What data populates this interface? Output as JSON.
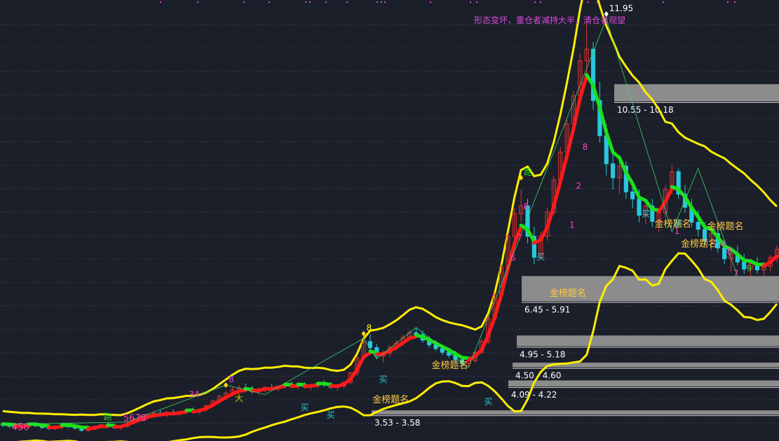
{
  "chart_data": {
    "type": "candlestick",
    "ylim": [
      3.0,
      12.2
    ],
    "peak_label": "11.95",
    "annotation_text": "形态变坏，重仓者减持大半，清仓者观望",
    "zones": [
      {
        "low": 10.18,
        "high": 10.55,
        "label": "10.55 - 10.18"
      },
      {
        "low": 5.91,
        "high": 6.45,
        "label": "6.45 - 5.91"
      },
      {
        "low": 4.95,
        "high": 5.18,
        "label": "4.95 - 5.18"
      },
      {
        "low": 4.5,
        "high": 4.6,
        "label": "4.50 - 4.60"
      },
      {
        "low": 4.09,
        "high": 4.22,
        "label": "4.09 - 4.22"
      },
      {
        "low": 3.53,
        "high": 3.58,
        "label": "3.53 - 3.58"
      }
    ],
    "series": [
      {
        "kind": "candles",
        "values": [
          [
            3.28,
            3.32,
            3.22,
            3.26
          ],
          [
            3.26,
            3.3,
            3.2,
            3.24
          ],
          [
            3.24,
            3.28,
            3.18,
            3.22
          ],
          [
            3.22,
            3.26,
            3.18,
            3.24
          ],
          [
            3.24,
            3.3,
            3.2,
            3.28
          ],
          [
            3.28,
            3.32,
            3.22,
            3.25
          ],
          [
            3.25,
            3.29,
            3.19,
            3.21
          ],
          [
            3.21,
            3.25,
            3.16,
            3.19
          ],
          [
            3.19,
            3.24,
            3.15,
            3.22
          ],
          [
            3.22,
            3.28,
            3.18,
            3.26
          ],
          [
            3.26,
            3.31,
            3.2,
            3.23
          ],
          [
            3.23,
            3.27,
            3.17,
            3.2
          ],
          [
            3.2,
            3.24,
            3.13,
            3.15
          ],
          [
            3.15,
            3.2,
            3.11,
            3.18
          ],
          [
            3.18,
            3.25,
            3.15,
            3.24
          ],
          [
            3.24,
            3.3,
            3.2,
            3.27
          ],
          [
            3.27,
            3.31,
            3.22,
            3.24
          ],
          [
            3.24,
            3.28,
            3.19,
            3.21
          ],
          [
            3.21,
            3.26,
            3.16,
            3.24
          ],
          [
            3.24,
            3.35,
            3.2,
            3.33
          ],
          [
            3.33,
            3.42,
            3.28,
            3.4
          ],
          [
            3.4,
            3.48,
            3.35,
            3.45
          ],
          [
            3.45,
            3.52,
            3.38,
            3.49
          ],
          [
            3.49,
            3.56,
            3.42,
            3.52
          ],
          [
            3.52,
            3.58,
            3.46,
            3.5
          ],
          [
            3.5,
            3.56,
            3.44,
            3.54
          ],
          [
            3.54,
            3.6,
            3.48,
            3.51
          ],
          [
            3.51,
            3.57,
            3.45,
            3.55
          ],
          [
            3.55,
            3.62,
            3.5,
            3.58
          ],
          [
            3.58,
            3.64,
            3.52,
            3.55
          ],
          [
            3.55,
            3.62,
            3.49,
            3.6
          ],
          [
            3.6,
            3.7,
            3.55,
            3.68
          ],
          [
            3.68,
            3.8,
            3.64,
            3.78
          ],
          [
            3.78,
            3.92,
            3.74,
            3.88
          ],
          [
            3.88,
            4.0,
            3.82,
            3.95
          ],
          [
            3.95,
            4.08,
            3.88,
            4.02
          ],
          [
            4.02,
            4.12,
            3.95,
            4.06
          ],
          [
            4.06,
            4.15,
            3.98,
            4.04
          ],
          [
            4.04,
            4.1,
            3.94,
            3.98
          ],
          [
            3.98,
            4.06,
            3.92,
            4.02
          ],
          [
            4.02,
            4.1,
            3.96,
            4.07
          ],
          [
            4.07,
            4.14,
            4.0,
            4.05
          ],
          [
            4.05,
            4.12,
            3.98,
            4.1
          ],
          [
            4.1,
            4.18,
            4.04,
            4.14
          ],
          [
            4.14,
            4.2,
            4.06,
            4.09
          ],
          [
            4.09,
            4.16,
            4.02,
            4.12
          ],
          [
            4.12,
            4.18,
            4.05,
            4.08
          ],
          [
            4.08,
            4.15,
            4.01,
            4.11
          ],
          [
            4.11,
            4.18,
            4.05,
            4.15
          ],
          [
            4.15,
            4.22,
            4.08,
            4.12
          ],
          [
            4.12,
            4.18,
            4.04,
            4.07
          ],
          [
            4.07,
            4.14,
            4.0,
            4.1
          ],
          [
            4.1,
            4.2,
            4.04,
            4.18
          ],
          [
            4.18,
            4.4,
            4.14,
            4.38
          ],
          [
            4.38,
            4.75,
            4.32,
            4.7
          ],
          [
            4.7,
            5.12,
            4.64,
            5.05
          ],
          [
            5.05,
            5.2,
            4.85,
            4.92
          ],
          [
            4.92,
            5.0,
            4.68,
            4.74
          ],
          [
            4.74,
            4.86,
            4.6,
            4.8
          ],
          [
            4.8,
            4.98,
            4.72,
            4.93
          ],
          [
            4.93,
            5.08,
            4.86,
            5.02
          ],
          [
            5.02,
            5.2,
            4.96,
            5.14
          ],
          [
            5.14,
            5.3,
            5.06,
            5.24
          ],
          [
            5.24,
            5.35,
            5.12,
            5.2
          ],
          [
            5.2,
            5.28,
            5.02,
            5.08
          ],
          [
            5.08,
            5.16,
            4.92,
            4.98
          ],
          [
            4.98,
            5.08,
            4.85,
            4.9
          ],
          [
            4.9,
            4.98,
            4.76,
            4.82
          ],
          [
            4.82,
            4.92,
            4.7,
            4.76
          ],
          [
            4.76,
            4.85,
            4.6,
            4.66
          ],
          [
            4.66,
            4.75,
            4.52,
            4.58
          ],
          [
            4.58,
            4.7,
            4.5,
            4.64
          ],
          [
            4.64,
            4.85,
            4.6,
            4.82
          ],
          [
            4.82,
            5.1,
            4.78,
            5.05
          ],
          [
            5.05,
            5.6,
            5.0,
            5.55
          ],
          [
            5.55,
            6.1,
            5.5,
            6.05
          ],
          [
            6.05,
            6.7,
            6.0,
            6.65
          ],
          [
            6.65,
            7.35,
            6.6,
            7.3
          ],
          [
            7.3,
            7.9,
            7.2,
            7.78
          ],
          [
            7.78,
            8.3,
            7.6,
            7.95
          ],
          [
            7.95,
            8.1,
            7.15,
            7.3
          ],
          [
            7.3,
            7.5,
            6.7,
            6.85
          ],
          [
            6.85,
            7.4,
            6.8,
            7.3
          ],
          [
            7.3,
            7.9,
            7.2,
            7.82
          ],
          [
            7.82,
            8.6,
            7.75,
            8.5
          ],
          [
            8.5,
            9.2,
            8.4,
            9.1
          ],
          [
            9.1,
            9.8,
            9.0,
            9.7
          ],
          [
            9.7,
            10.4,
            9.6,
            10.3
          ],
          [
            10.3,
            11.2,
            10.2,
            11.05
          ],
          [
            11.05,
            11.95,
            10.7,
            11.3
          ],
          [
            11.3,
            11.45,
            10.0,
            10.2
          ],
          [
            10.2,
            10.6,
            9.3,
            9.45
          ],
          [
            9.45,
            9.7,
            8.6,
            8.85
          ],
          [
            8.85,
            9.1,
            8.3,
            8.55
          ],
          [
            8.55,
            8.95,
            8.2,
            8.8
          ],
          [
            8.8,
            8.9,
            8.1,
            8.25
          ],
          [
            8.25,
            8.5,
            7.9,
            8.1
          ],
          [
            8.1,
            8.3,
            7.6,
            7.75
          ],
          [
            7.75,
            8.05,
            7.55,
            7.95
          ],
          [
            7.95,
            8.1,
            7.5,
            7.62
          ],
          [
            7.62,
            7.9,
            7.4,
            7.8
          ],
          [
            7.8,
            8.4,
            7.7,
            8.3
          ],
          [
            8.3,
            8.8,
            8.2,
            8.68
          ],
          [
            8.68,
            8.75,
            8.1,
            8.2
          ],
          [
            8.2,
            8.4,
            7.8,
            7.92
          ],
          [
            7.92,
            8.1,
            7.5,
            7.6
          ],
          [
            7.6,
            7.85,
            7.3,
            7.45
          ],
          [
            7.45,
            7.6,
            7.1,
            7.2
          ],
          [
            7.2,
            7.45,
            7.0,
            7.36
          ],
          [
            7.36,
            7.5,
            6.95,
            7.05
          ],
          [
            7.05,
            7.2,
            6.7,
            6.82
          ],
          [
            6.82,
            7.0,
            6.55,
            6.92
          ],
          [
            6.92,
            7.1,
            6.68,
            6.75
          ],
          [
            6.75,
            6.92,
            6.5,
            6.6
          ],
          [
            6.6,
            6.82,
            6.45,
            6.72
          ],
          [
            6.72,
            6.85,
            6.5,
            6.58
          ],
          [
            6.58,
            6.75,
            6.45,
            6.66
          ],
          [
            6.66,
            6.9,
            6.55,
            6.85
          ],
          [
            6.85,
            7.1,
            6.75,
            7.02
          ]
        ]
      },
      {
        "name": "",
        "kind": "fast_line"
      },
      {
        "name": "",
        "kind": "bands"
      }
    ],
    "markers": [
      {
        "i": 34,
        "text": "8",
        "price": 4.12,
        "color": "#d040ff"
      },
      {
        "i": 55,
        "text": "8",
        "price": 5.22,
        "color": "#ffff00"
      },
      {
        "i": 79,
        "text": "跑",
        "price": 8.55,
        "color": "#22dd22"
      },
      {
        "i": 92,
        "text": "11.95",
        "price": 12.05,
        "color": "#ffffff"
      }
    ],
    "text_labels": [
      {
        "i": 16,
        "text": "跑",
        "price": 3.38,
        "color": "#22dd22"
      },
      {
        "i": 36,
        "text": "大",
        "price": 3.78,
        "color": "#cccc00"
      },
      {
        "i": 46,
        "text": "买",
        "price": 3.58,
        "color": "#22cccc"
      },
      {
        "i": 50,
        "text": "买",
        "price": 3.42,
        "color": "#22cccc"
      },
      {
        "i": 58,
        "text": "买",
        "price": 4.18,
        "color": "#22cccc"
      },
      {
        "i": 57,
        "text": "金榜题名",
        "price": 3.75,
        "color": "#ffcc44"
      },
      {
        "i": 66,
        "text": "金榜题名",
        "price": 4.48,
        "color": "#ffcc44"
      },
      {
        "i": 74,
        "text": "买",
        "price": 3.7,
        "color": "#22cccc"
      },
      {
        "i": 82,
        "text": "买",
        "price": 6.8,
        "color": "#22cccc"
      },
      {
        "i": 84,
        "text": "金榜题名",
        "price": 6.02,
        "color": "#ffcc44"
      },
      {
        "i": 98,
        "text": "买",
        "price": 7.72,
        "color": "#22cccc"
      },
      {
        "i": 100,
        "text": "金榜题名",
        "price": 7.5,
        "color": "#ffcc44"
      },
      {
        "i": 103,
        "text": "买",
        "price": 7.52,
        "color": "#22cccc"
      },
      {
        "i": 104,
        "text": "金榜题名",
        "price": 7.08,
        "color": "#ffcc44"
      },
      {
        "i": 108,
        "text": "金榜题名",
        "price": 7.45,
        "color": "#ffcc44"
      },
      {
        "i": 120,
        "text": "买",
        "price": 6.55,
        "color": "#22cccc"
      },
      {
        "i": 80,
        "text": "8",
        "price": 7.88,
        "color": "#ff40c0"
      },
      {
        "i": 79,
        "text": "7",
        "price": 7.2,
        "color": "#ff40c0"
      },
      {
        "i": 78,
        "text": "6",
        "price": 6.78,
        "color": "#ff40c0"
      },
      {
        "i": 87,
        "text": "1",
        "price": 7.48,
        "color": "#ff40c0"
      },
      {
        "i": 88,
        "text": "2",
        "price": 8.32,
        "color": "#ff40c0"
      },
      {
        "i": 89,
        "text": "8",
        "price": 9.15,
        "color": "#ff40c0"
      },
      {
        "i": 103,
        "text": "1",
        "price": 7.35,
        "color": "#ff40c0"
      },
      {
        "i": 110,
        "text": "4",
        "price": 7.08,
        "color": "#ff40c0"
      },
      {
        "i": 111,
        "text": "8",
        "price": 6.92,
        "color": "#ff40c0"
      },
      {
        "i": 112,
        "text": "7",
        "price": 6.45,
        "color": "#ff40c0"
      },
      {
        "i": 114,
        "text": "9",
        "price": 6.55,
        "color": "#22dd22"
      },
      {
        "i": 29,
        "text": "34",
        "price": 3.86,
        "color": "#ff40c0"
      },
      {
        "i": 19,
        "text": "5678",
        "price": 3.35,
        "color": "#ff40c0"
      },
      {
        "i": 2,
        "text": "456",
        "price": 3.16,
        "color": "#ff40c0"
      }
    ],
    "top_dots": [
      228,
      281,
      347,
      383,
      435,
      441,
      464,
      494,
      537,
      543,
      548,
      613,
      670,
      679,
      762,
      770,
      838,
      851,
      945,
      1037,
      1047
    ]
  },
  "colors": {
    "background": "#1b1f2a",
    "grid": "#343b4a",
    "up": "#e63333",
    "down": "#29c8e0",
    "band": "#ffee00",
    "fast_up": "#ff1a1a",
    "fast_down": "#1ae01a",
    "zone": "#8c8c8c",
    "zone_line": "#cfcfcf",
    "magenta": "#d94ad9",
    "white": "#ffffff"
  }
}
